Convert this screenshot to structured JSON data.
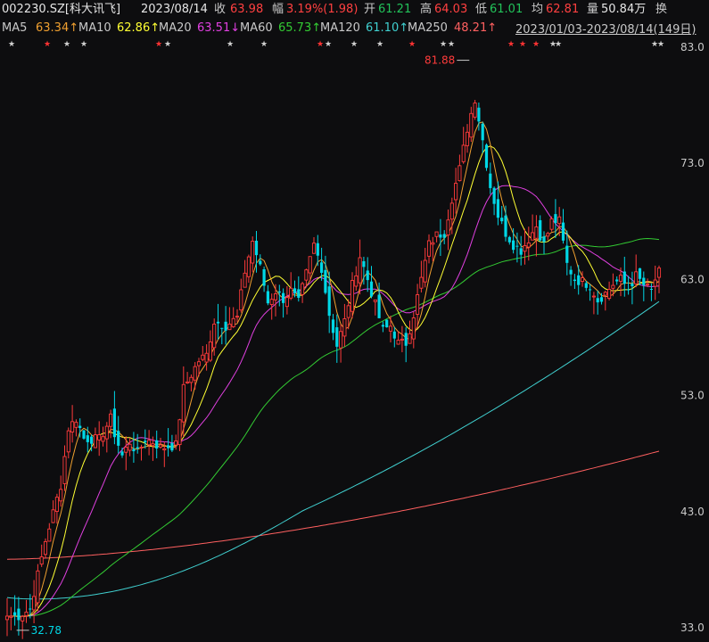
{
  "header": {
    "code": "002230.SZ[科大讯飞]",
    "date": "2023/08/14",
    "close_label": "收",
    "close": "63.98",
    "change_label": "幅",
    "change": "3.19%(1.98)",
    "open_label": "开",
    "open": "61.21",
    "high_label": "高",
    "high": "64.03",
    "low_label": "低",
    "low": "61.01",
    "avg_label": "均",
    "avg": "62.81",
    "volume_label": "量",
    "volume": "50.84万",
    "turnover_label": "换"
  },
  "ma_bar": {
    "items": [
      {
        "label": "MA5",
        "value": "63.34↑",
        "color": "#f0a030"
      },
      {
        "label": "MA10",
        "value": "62.86↑",
        "color": "#ffff33"
      },
      {
        "label": "MA20",
        "value": "63.51↓",
        "color": "#e040e0"
      },
      {
        "label": "MA60",
        "value": "65.73↑",
        "color": "#33cc33"
      },
      {
        "label": "MA120",
        "value": "61.10↑",
        "color": "#40d0d0"
      },
      {
        "label": "MA250",
        "value": "48.21↑",
        "color": "#ff6060"
      }
    ],
    "range": "2023/01/03-2023/08/14(149日)"
  },
  "colors": {
    "up": "#ff3b3b",
    "down": "#00d7e6",
    "ma5": "#f0a030",
    "ma10": "#ffff33",
    "ma20": "#e040e0",
    "ma60": "#33cc33",
    "ma120": "#40d0d0",
    "ma250": "#ff6060",
    "axis_text": "#c8c8c8",
    "star": "#d0d0d0",
    "star_red": "#ff3333"
  },
  "chart_data": {
    "type": "candlestick",
    "x_range": [
      "2023/01/03",
      "2023/08/14"
    ],
    "y_ticks": [
      83.0,
      73.0,
      63.0,
      53.0,
      43.0,
      33.0
    ],
    "ylim": [
      33.0,
      83.0
    ],
    "annotations": [
      {
        "text": "81.88",
        "value": 81.88,
        "index": 121,
        "side": "left"
      },
      {
        "text": "32.78",
        "value": 32.78,
        "index": 2,
        "side": "right"
      }
    ],
    "key_points": [
      [
        0,
        34.0
      ],
      [
        3,
        34.0
      ],
      [
        6,
        34.6
      ],
      [
        10,
        40.5
      ],
      [
        14,
        45.3
      ],
      [
        16,
        50.2
      ],
      [
        18,
        51.0
      ],
      [
        20,
        49.3
      ],
      [
        24,
        49.2
      ],
      [
        27,
        51.0
      ],
      [
        28,
        49.7
      ],
      [
        30,
        47.8
      ],
      [
        32,
        49.0
      ],
      [
        34,
        48.0
      ],
      [
        36,
        49.2
      ],
      [
        38,
        49.0
      ],
      [
        40,
        48.5
      ],
      [
        44,
        48.7
      ],
      [
        46,
        53.6
      ],
      [
        50,
        56.0
      ],
      [
        52,
        56.5
      ],
      [
        54,
        59.4
      ],
      [
        57,
        59.0
      ],
      [
        60,
        59.7
      ],
      [
        62,
        63.7
      ],
      [
        64,
        66.3
      ],
      [
        66,
        64.0
      ],
      [
        68,
        61.0
      ],
      [
        70,
        62.0
      ],
      [
        72,
        61.3
      ],
      [
        74,
        62.0
      ],
      [
        76,
        61.0
      ],
      [
        78,
        63.5
      ],
      [
        80,
        66.0
      ],
      [
        82,
        64.0
      ],
      [
        84,
        60.0
      ],
      [
        86,
        57.3
      ],
      [
        88,
        59.4
      ],
      [
        90,
        62.5
      ],
      [
        92,
        65.0
      ],
      [
        94,
        63.0
      ],
      [
        96,
        60.8
      ],
      [
        98,
        58.6
      ],
      [
        100,
        59.0
      ],
      [
        102,
        57.5
      ],
      [
        104,
        57.5
      ],
      [
        106,
        60.0
      ],
      [
        108,
        63.0
      ],
      [
        110,
        66.0
      ],
      [
        112,
        66.8
      ],
      [
        114,
        67.0
      ],
      [
        116,
        70.0
      ],
      [
        118,
        72.5
      ],
      [
        120,
        76.0
      ],
      [
        122,
        78.6
      ],
      [
        124,
        75.0
      ],
      [
        126,
        71.0
      ],
      [
        128,
        68.5
      ],
      [
        130,
        67.0
      ],
      [
        132,
        66.0
      ],
      [
        134,
        65.5
      ],
      [
        136,
        66.5
      ],
      [
        138,
        67.6
      ],
      [
        140,
        66.0
      ],
      [
        142,
        68.0
      ],
      [
        144,
        68.0
      ],
      [
        146,
        64.3
      ],
      [
        148,
        63.0
      ],
      [
        150,
        62.8
      ],
      [
        152,
        62.5
      ],
      [
        154,
        61.2
      ],
      [
        156,
        61.8
      ],
      [
        158,
        62.6
      ],
      [
        160,
        63.0
      ],
      [
        162,
        62.2
      ],
      [
        164,
        63.3
      ],
      [
        166,
        62.5
      ],
      [
        168,
        62.0
      ],
      [
        170,
        63.98
      ]
    ],
    "ma_values": {
      "MA5": 63.34,
      "MA10": 62.86,
      "MA20": 63.51,
      "MA60": 65.73,
      "MA120": 61.1,
      "MA250": 48.21
    }
  }
}
